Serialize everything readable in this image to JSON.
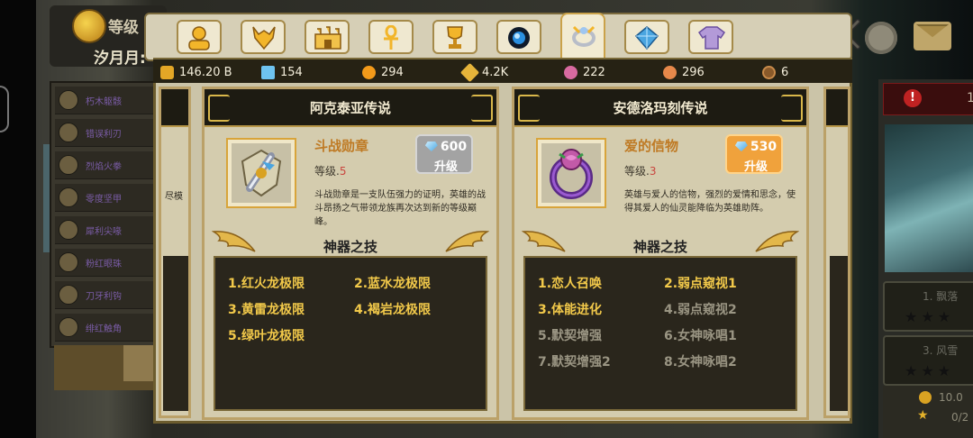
{
  "player": {
    "level_label": "等级",
    "name": "汐月月:"
  },
  "left_list": [
    "朽木躯骸",
    "错误利刃",
    "烈焰火拳",
    "零度坚甲",
    "犀利尖喙",
    "粉红眼珠",
    "刀牙利钩",
    "绯红触角"
  ],
  "tabs": [
    {
      "name": "hero",
      "icon": "person-icon",
      "active": false
    },
    {
      "name": "dragon",
      "icon": "dragon-head-icon",
      "active": false
    },
    {
      "name": "castle",
      "icon": "castle-icon",
      "active": false
    },
    {
      "name": "ankh",
      "icon": "ankh-icon",
      "active": false
    },
    {
      "name": "trophy",
      "icon": "trophy-icon",
      "active": false
    },
    {
      "name": "orb",
      "icon": "orb-icon",
      "active": false
    },
    {
      "name": "artifact",
      "icon": "artifact-ring-icon",
      "active": true
    },
    {
      "name": "crystal",
      "icon": "crystal-icon",
      "active": false
    },
    {
      "name": "shirt",
      "icon": "shirt-icon",
      "active": false
    }
  ],
  "currency": {
    "gold": "146.20 B",
    "gems": "154",
    "orbs": "294",
    "fragments": "4.2K",
    "souls": "222",
    "hero_tokens": "296",
    "cookies": "6"
  },
  "colors": {
    "gold": "#e4a726",
    "gem": "#6ec3f0",
    "upgrade_gray": "#9c9c9c",
    "upgrade_orange": "#f0a23c",
    "skill_active": "#f2c94a",
    "skill_inactive": "#9a9583"
  },
  "cards": [
    {
      "title": "阿克泰亚传说",
      "item_name": "斗战勋章",
      "level_label": "等级.",
      "level": "5",
      "cost": "600",
      "action": "升级",
      "description": "斗战勋章是一支队伍强力的证明，英雄的战斗昂扬之气带领龙族再次达到新的等级巅峰。",
      "skills_title": "神器之技",
      "skills": [
        {
          "text": "1.红火龙极限",
          "active": true
        },
        {
          "text": "2.蓝水龙极限",
          "active": true
        },
        {
          "text": "3.黄雷龙极限",
          "active": true
        },
        {
          "text": "4.褐岩龙极限",
          "active": true
        },
        {
          "text": "5.绿叶龙极限",
          "active": true
        }
      ]
    },
    {
      "title": "安德洛玛刻传说",
      "item_name": "爱的信物",
      "level_label": "等级.",
      "level": "3",
      "cost": "530",
      "action": "升级",
      "description": "英雄与爱人的信物，强烈的爱情和思念，使得其爱人的仙灵能降临为英雄助阵。",
      "skills_title": "神器之技",
      "skills": [
        {
          "text": "1.恋人召唤",
          "active": true
        },
        {
          "text": "2.弱点窥视1",
          "active": true
        },
        {
          "text": "3.体能进化",
          "active": true
        },
        {
          "text": "4.弱点窥视2",
          "active": false
        },
        {
          "text": "5.默契增强",
          "active": false
        },
        {
          "text": "6.女神咏唱1",
          "active": false
        },
        {
          "text": "7.默契增强2",
          "active": false
        },
        {
          "text": "8.女神咏唱2",
          "active": false
        }
      ]
    }
  ],
  "peek_left": "尽模",
  "right_side": {
    "badge": "1",
    "card1": "1. 飘落",
    "card2": "3. 风雪",
    "gold": "10.0",
    "stars": "0/2"
  }
}
